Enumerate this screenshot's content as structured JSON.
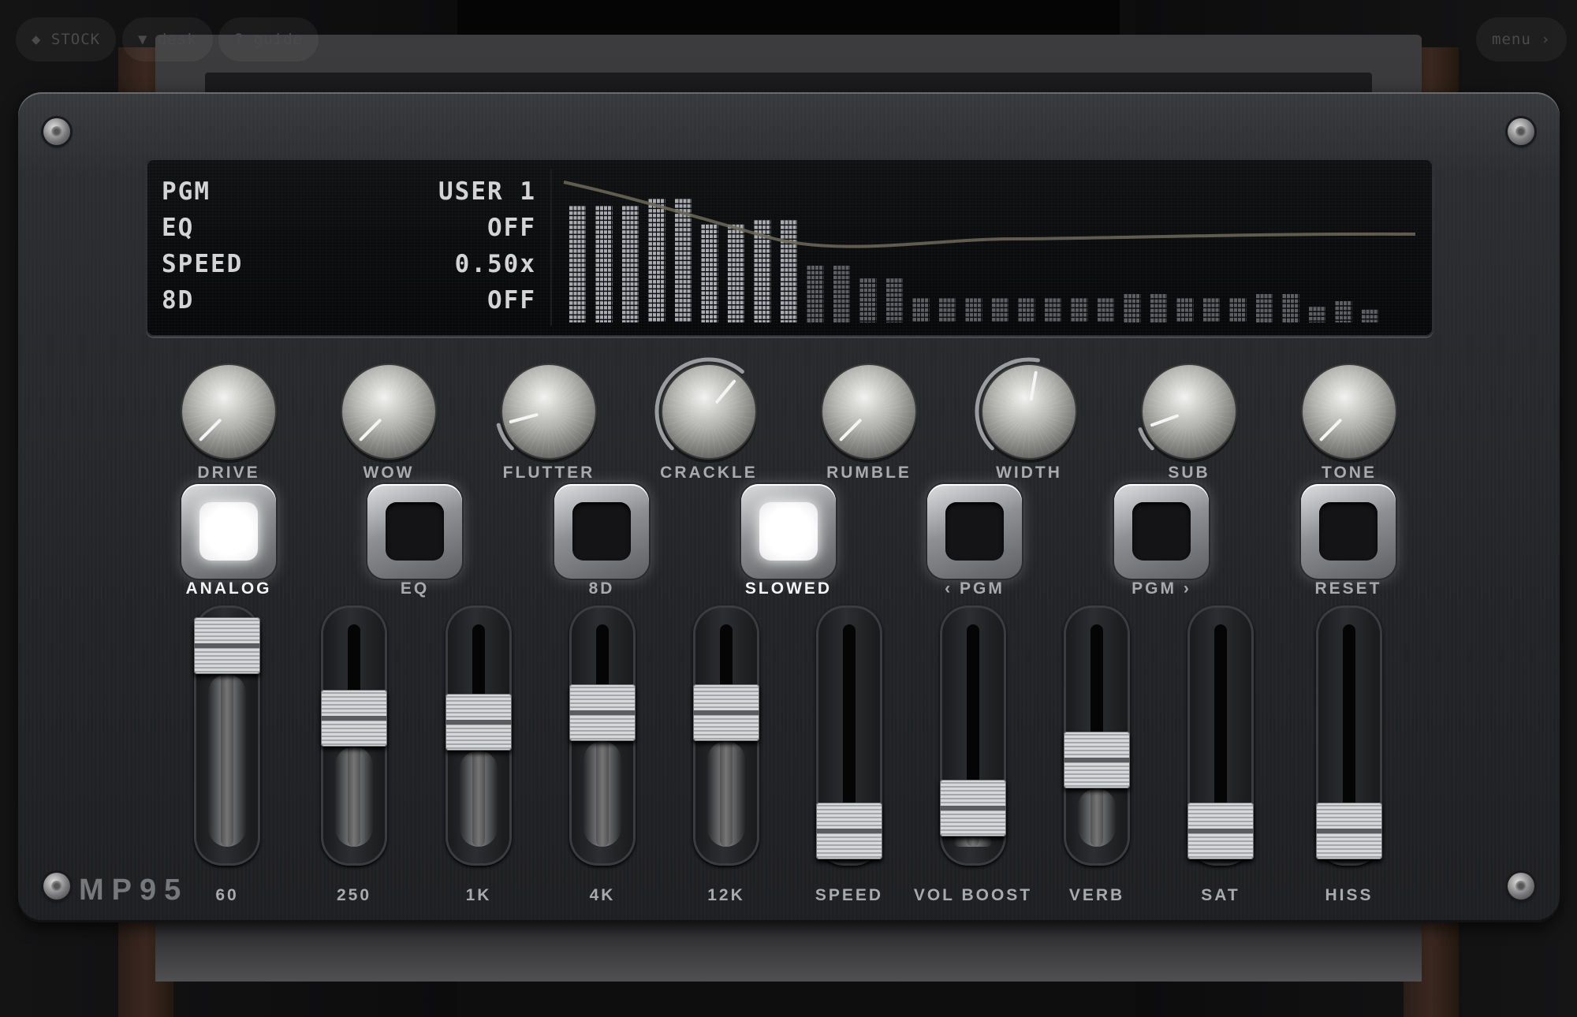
{
  "nav": {
    "stock_label": "◆ STOCK",
    "desk_label": "▼ desk",
    "guide_label": "? guide",
    "menu_label": "menu ›"
  },
  "device": {
    "brand": "MP95"
  },
  "display": {
    "rows": [
      {
        "key": "PGM",
        "value": "USER 1"
      },
      {
        "key": "EQ",
        "value": "OFF"
      },
      {
        "key": "SPEED",
        "value": "0.50x"
      },
      {
        "key": "8D",
        "value": "OFF"
      }
    ],
    "spectrum_levels": [
      0.82,
      0.82,
      0.82,
      0.87,
      0.87,
      0.69,
      0.69,
      0.72,
      0.72,
      0.4,
      0.4,
      0.31,
      0.31,
      0.17,
      0.17,
      0.17,
      0.17,
      0.17,
      0.17,
      0.17,
      0.17,
      0.2,
      0.2,
      0.17,
      0.17,
      0.17,
      0.2,
      0.2,
      0.11,
      0.15,
      0.09
    ]
  },
  "knobs": [
    {
      "label": "DRIVE",
      "arc": false,
      "angle": -135
    },
    {
      "label": "WOW",
      "arc": false,
      "angle": -135
    },
    {
      "label": "FLUTTER",
      "arc": true,
      "angle": -105
    },
    {
      "label": "CRACKLE",
      "arc": true,
      "angle": 40
    },
    {
      "label": "RUMBLE",
      "arc": false,
      "angle": -135
    },
    {
      "label": "WIDTH",
      "arc": true,
      "angle": 10
    },
    {
      "label": "SUB",
      "arc": true,
      "angle": -110
    },
    {
      "label": "TONE",
      "arc": false,
      "angle": -135
    }
  ],
  "buttons": [
    {
      "label": "ANALOG",
      "on": true
    },
    {
      "label": "EQ",
      "on": false
    },
    {
      "label": "8D",
      "on": false
    },
    {
      "label": "SLOWED",
      "on": true
    },
    {
      "label": "‹ PGM",
      "on": false
    },
    {
      "label": "PGM ›",
      "on": false
    },
    {
      "label": "RESET",
      "on": false
    }
  ],
  "faders": [
    {
      "label": "60",
      "level": 0.97
    },
    {
      "label": "250",
      "level": 0.59
    },
    {
      "label": "1K",
      "level": 0.57
    },
    {
      "label": "4K",
      "level": 0.62
    },
    {
      "label": "12K",
      "level": 0.62
    },
    {
      "label": "SPEED",
      "level": 0.0
    },
    {
      "label": "VOL BOOST",
      "level": 0.12
    },
    {
      "label": "VERB",
      "level": 0.37
    },
    {
      "label": "SAT",
      "level": 0.0
    },
    {
      "label": "HISS",
      "level": 0.0
    }
  ],
  "colors": {
    "panel": "#2a2b2e",
    "lcd_text": "#d4d4d6",
    "led_on": "#ffffff"
  }
}
